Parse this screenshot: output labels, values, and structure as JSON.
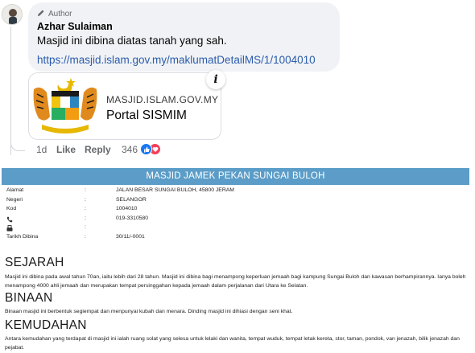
{
  "comment": {
    "badge": "Author",
    "author": "Azhar Sulaiman",
    "text": "Masjid ini dibina diatas tanah yang sah.",
    "link": "https://masjid.islam.gov.my/maklumatDetailMS/1/1004010",
    "preview": {
      "domain": "MASJID.ISLAM.GOV.MY",
      "title": "Portal SISMIM"
    },
    "info_label": "i",
    "actions": {
      "time": "1d",
      "like": "Like",
      "reply": "Reply",
      "reaction_count": "346"
    },
    "colors": {
      "link": "#2b5cad",
      "bubble": "#f0f2f5",
      "like": "#1877f2",
      "love": "#f33e58"
    }
  },
  "mosque": {
    "header": "MASJID JAMEK PEKAN SUNGAI BULOH",
    "header_color": "#5b9dc8",
    "fields": [
      {
        "label": "Alamat",
        "value": "JALAN BESAR SUNGAI BULOH, 45800 JERAM",
        "icon": ""
      },
      {
        "label": "Negeri",
        "value": "SELANGOR",
        "icon": ""
      },
      {
        "label": "Kod",
        "value": "1004010",
        "icon": ""
      },
      {
        "label": "",
        "value": "019-3310580",
        "icon": "phone-icon"
      },
      {
        "label": "",
        "value": "",
        "icon": "fax-icon"
      },
      {
        "label": "Tarikh Dibina",
        "value": "30/11/-0001",
        "icon": ""
      }
    ],
    "sections": [
      {
        "title": "SEJARAH",
        "body": "Masjid ini dibina pada awal tahun 70an, iaitu lebih dari 28 tahun. Masjid ini dibina bagi menampong keperluan jemaah bagi kampung Sungai Buloh dan kawasan berhampirannya. Ianya boleh menampong 4000 ahli jemaah dan merupakan tempat persinggahan kepada jemaah dalam perjalanan dari Utara ke Selatan."
      },
      {
        "title": "BINAAN",
        "body": "Binaan masjid ini berbentuk segiempat dan menpunyai kubah dan menara. Dinding masjid ini dihiasi dengan seni khat."
      },
      {
        "title": "KEMUDAHAN",
        "body": "Antara kemudahan yang terdapat di masjid ini ialah ruang solat yang selesa untuk lelaki dan wanita, tempat wuduk, tempat letak kereta, stor, taman, pondok, van jenazah, bilik jenazah dan pejabat."
      }
    ]
  }
}
